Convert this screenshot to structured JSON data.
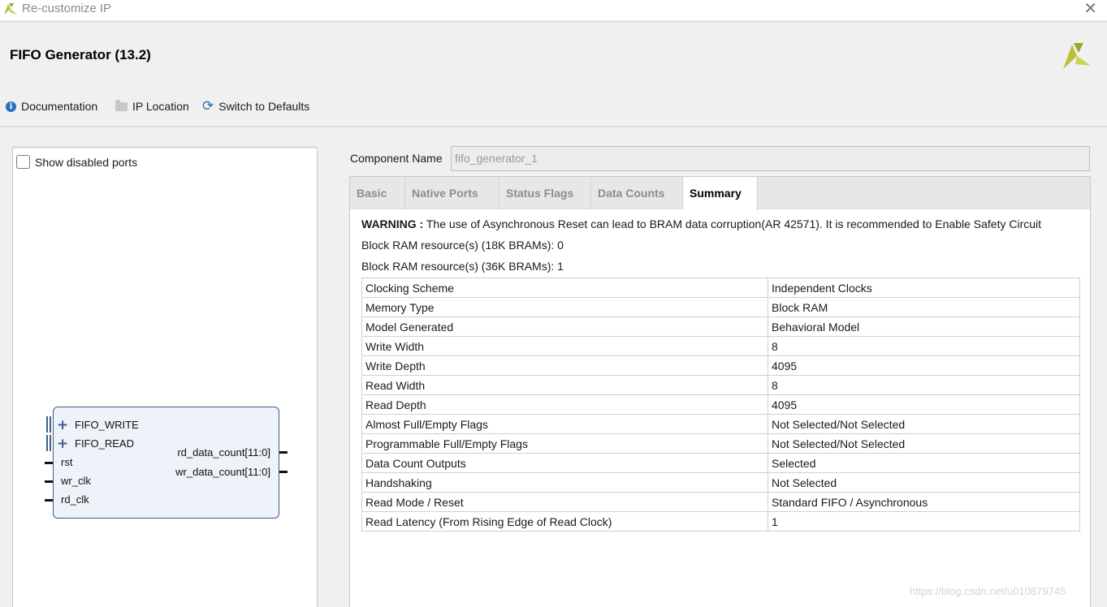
{
  "window": {
    "title": "Re-customize IP",
    "close_glyph": "✕"
  },
  "header": {
    "ip_name": "FIFO Generator (13.2)",
    "logo": "xilinx-logo"
  },
  "toolbar": {
    "documentation": "Documentation",
    "ip_location": "IP Location",
    "switch_defaults": "Switch to Defaults"
  },
  "left_panel": {
    "show_disabled_ports": "Show disabled ports",
    "show_disabled_checked": false,
    "block": {
      "bus_ports": [
        "FIFO_WRITE",
        "FIFO_READ"
      ],
      "input_ports": [
        "rst",
        "wr_clk",
        "rd_clk"
      ],
      "output_ports": [
        "rd_data_count[11:0]",
        "wr_data_count[11:0]"
      ]
    }
  },
  "component": {
    "label": "Component Name",
    "value": "fifo_generator_1"
  },
  "tabs": [
    "Basic",
    "Native Ports",
    "Status Flags",
    "Data Counts",
    "Summary"
  ],
  "active_tab": "Summary",
  "summary": {
    "warning_label": "WARNING :",
    "warning_text": "The use of Asynchronous Reset can lead to BRAM data corruption(AR 42571). It is recommended to Enable Safety Circuit",
    "bram_18k": "Block RAM resource(s) (18K BRAMs): 0",
    "bram_36k": "Block RAM resource(s) (36K BRAMs): 1",
    "rows": [
      [
        "Clocking Scheme",
        "Independent Clocks"
      ],
      [
        "Memory Type",
        "Block RAM"
      ],
      [
        "Model Generated",
        "Behavioral Model"
      ],
      [
        "Write Width",
        "8"
      ],
      [
        "Write Depth",
        "4095"
      ],
      [
        "Read Width",
        "8"
      ],
      [
        "Read Depth",
        "4095"
      ],
      [
        "Almost Full/Empty Flags",
        "Not Selected/Not Selected"
      ],
      [
        "Programmable Full/Empty Flags",
        "Not Selected/Not Selected"
      ],
      [
        "Data Count Outputs",
        "Selected"
      ],
      [
        "Handshaking",
        "Not Selected"
      ],
      [
        "Read Mode / Reset",
        "Standard FIFO / Asynchronous"
      ],
      [
        "Read Latency (From Rising Edge of Read Clock)",
        "1"
      ]
    ]
  },
  "watermark": "https://blog.csdn.net/u010879745",
  "colors": {
    "accent": "#2c6fbd",
    "block_border": "#3c5e8c",
    "block_fill": "#eef2f9"
  }
}
